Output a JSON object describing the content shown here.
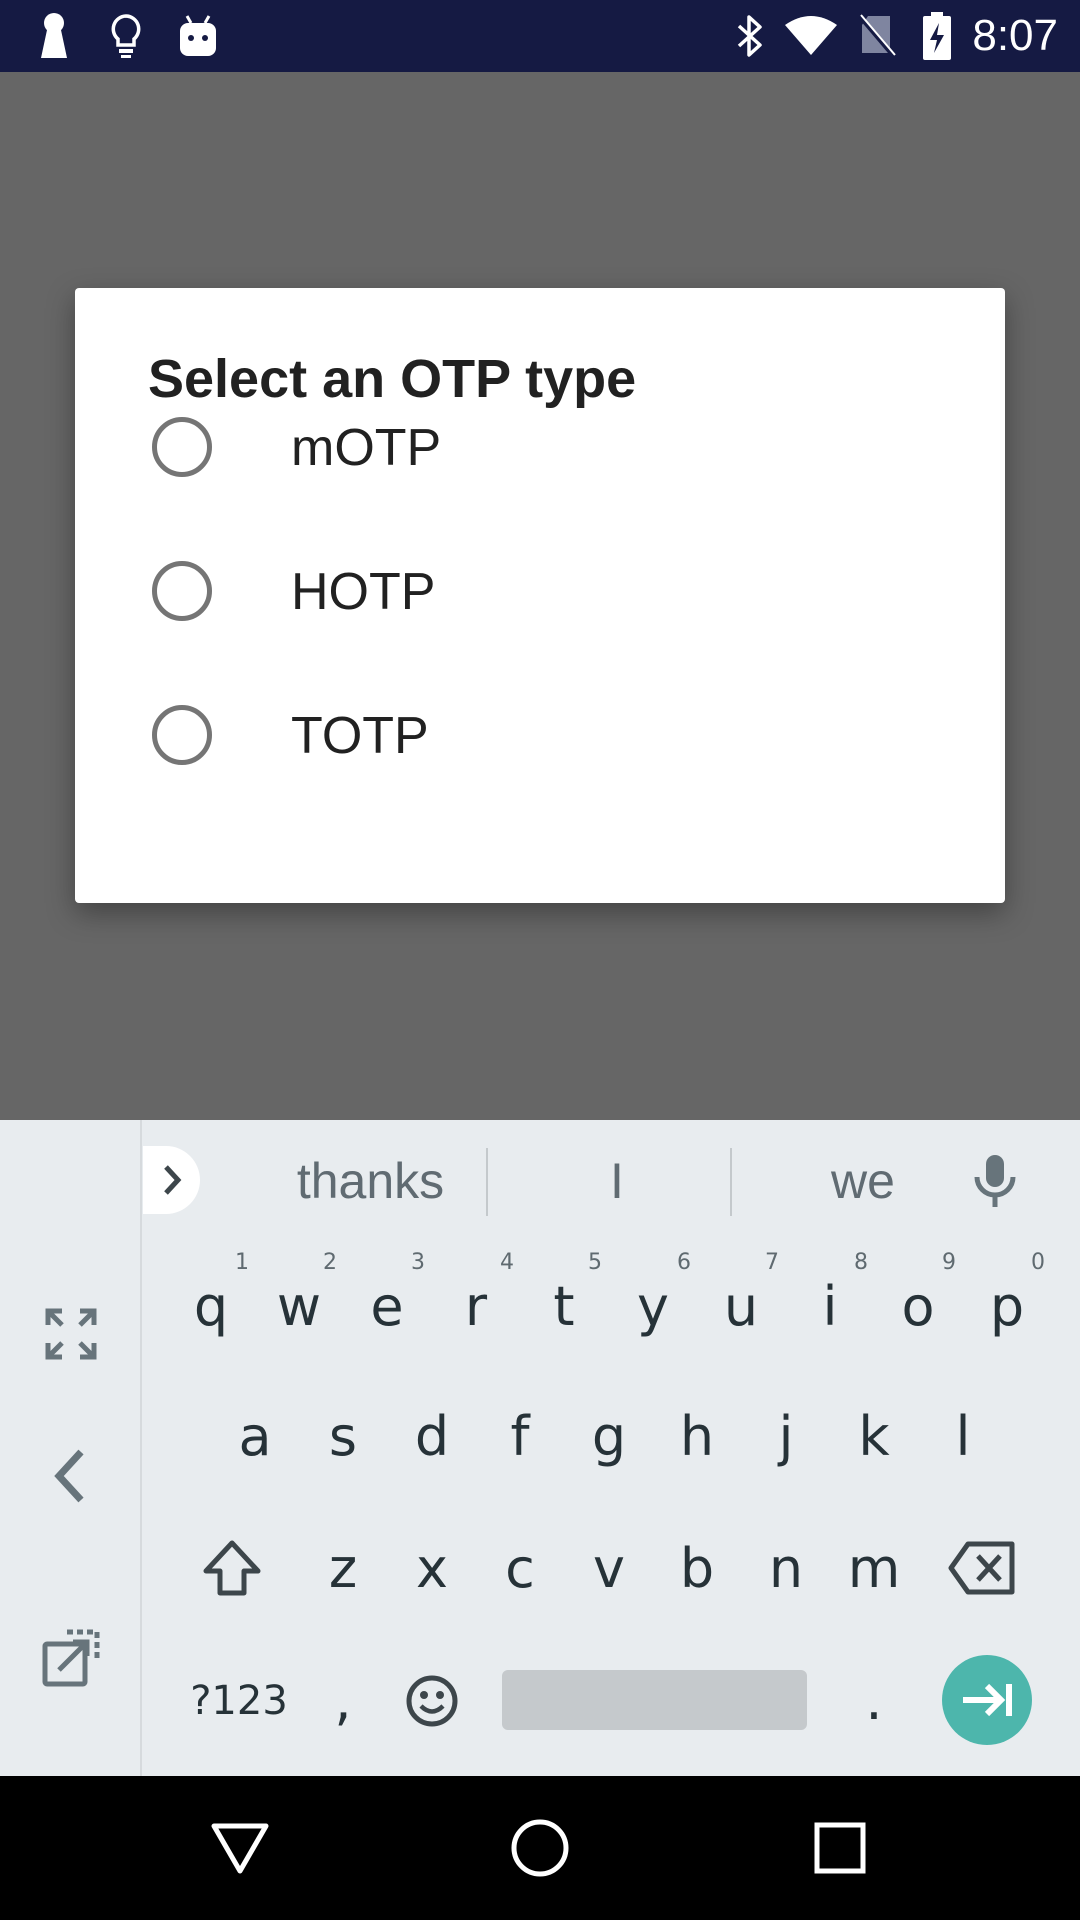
{
  "status_bar": {
    "time": "8:07",
    "left_icons": [
      "keyhole-icon",
      "lightbulb-icon",
      "android-icon"
    ],
    "right_icons": [
      "bluetooth-icon",
      "wifi-icon",
      "no-sim-icon",
      "battery-charging-icon"
    ],
    "background": "#151a43"
  },
  "dialog": {
    "title": "Select an OTP type",
    "options": [
      {
        "label": "mOTP",
        "selected": false
      },
      {
        "label": "HOTP",
        "selected": false
      },
      {
        "label": "TOTP",
        "selected": false
      }
    ]
  },
  "keyboard": {
    "suggestions": [
      "thanks",
      "I",
      "we"
    ],
    "row1": [
      {
        "key": "q",
        "hint": "1"
      },
      {
        "key": "w",
        "hint": "2"
      },
      {
        "key": "e",
        "hint": "3"
      },
      {
        "key": "r",
        "hint": "4"
      },
      {
        "key": "t",
        "hint": "5"
      },
      {
        "key": "y",
        "hint": "6"
      },
      {
        "key": "u",
        "hint": "7"
      },
      {
        "key": "i",
        "hint": "8"
      },
      {
        "key": "o",
        "hint": "9"
      },
      {
        "key": "p",
        "hint": "0"
      }
    ],
    "row2": [
      "a",
      "s",
      "d",
      "f",
      "g",
      "h",
      "j",
      "k",
      "l"
    ],
    "row3": [
      "z",
      "x",
      "c",
      "v",
      "b",
      "n",
      "m"
    ],
    "symbols_label": "?123",
    "comma": ",",
    "period": ".",
    "accent": "#4db6ac"
  },
  "nav_bar": {
    "buttons": [
      "back-icon",
      "home-icon",
      "recents-icon"
    ]
  }
}
